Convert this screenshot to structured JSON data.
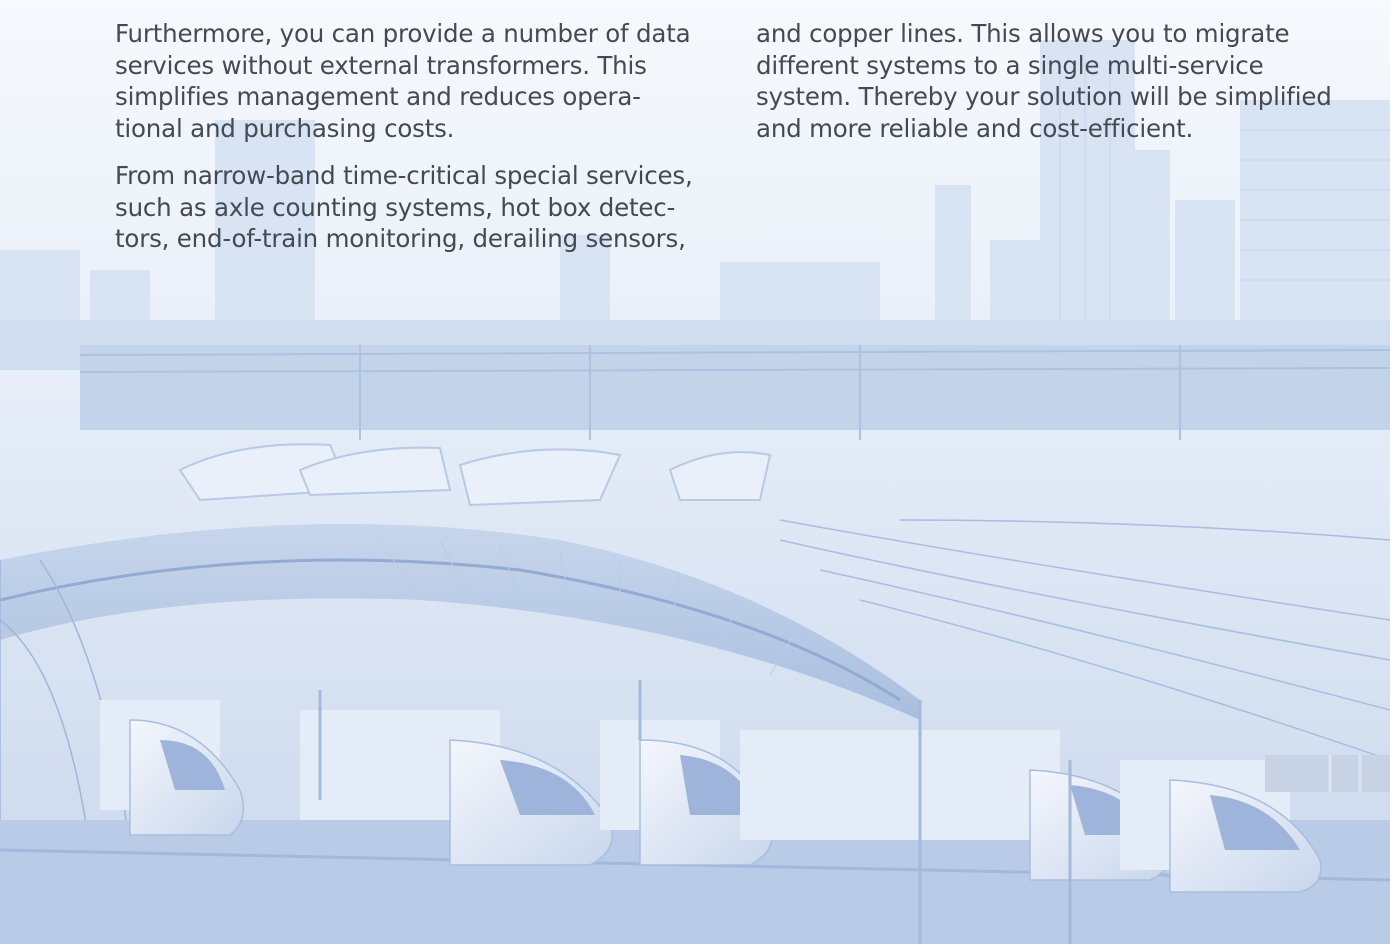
{
  "page": {
    "columns": [
      {
        "paragraphs": [
          "Furthermore, you can provide a number of data\nservices without external transformers. This\nsimplifies management and reduces opera-\ntional and purchasing costs.",
          "From narrow-band time-critical special services,\nsuch as axle counting systems, hot box detec-\ntors, end-of-train monitoring, derailing sensors,"
        ]
      },
      {
        "paragraphs": [
          "and copper lines. This allows you to migrate\ndifferent systems to a single multi-service\nsystem. Thereby your solution will be simplified\nand more reliable and cost-efficient."
        ]
      }
    ]
  },
  "colors": {
    "background": "#e6eef9",
    "tint_light": "#d2def0",
    "tint_mid": "#b6c7e2",
    "tint_dark": "#96acd2",
    "text": "#454a52"
  }
}
